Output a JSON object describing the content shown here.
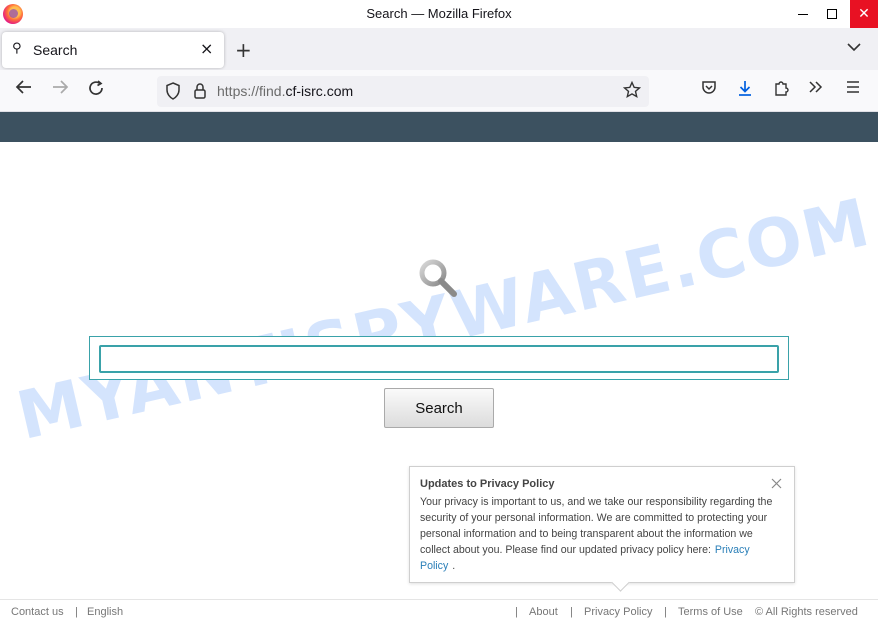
{
  "window": {
    "title": "Search — Mozilla Firefox"
  },
  "tabs": [
    {
      "label": "Search"
    }
  ],
  "urlbar": {
    "prefix": "https://find.",
    "host": "cf-isrc.com"
  },
  "watermark": "MYANTISPYWARE.COM",
  "search": {
    "input_value": "",
    "button_label": "Search"
  },
  "privacy": {
    "title": "Updates to Privacy Policy",
    "body": "Your privacy is important to us, and we take our responsibility regarding the security of your personal information. We are committed to protecting your personal information and to being transparent about the information we collect about you. Please find our updated privacy policy here:",
    "link_label": "Privacy Policy",
    "trailing": "."
  },
  "footer": {
    "contact": "Contact us",
    "sep": "|",
    "language": "English",
    "about": "About",
    "privacy": "Privacy Policy",
    "terms": "Terms of Use",
    "copyright": "© All Rights reserved"
  },
  "colors": {
    "band": "#3c5160",
    "accent": "#3aa2a9",
    "close_red": "#e81123"
  },
  "icons": [
    "firefox-logo-icon",
    "search-icon",
    "close-icon",
    "plus-icon",
    "chevron-down-icon",
    "back-arrow-icon",
    "forward-arrow-icon",
    "reload-icon",
    "shield-icon",
    "lock-icon",
    "star-icon",
    "pocket-icon",
    "download-icon",
    "extensions-icon",
    "overflow-icon",
    "menu-icon",
    "magnifier-icon"
  ]
}
